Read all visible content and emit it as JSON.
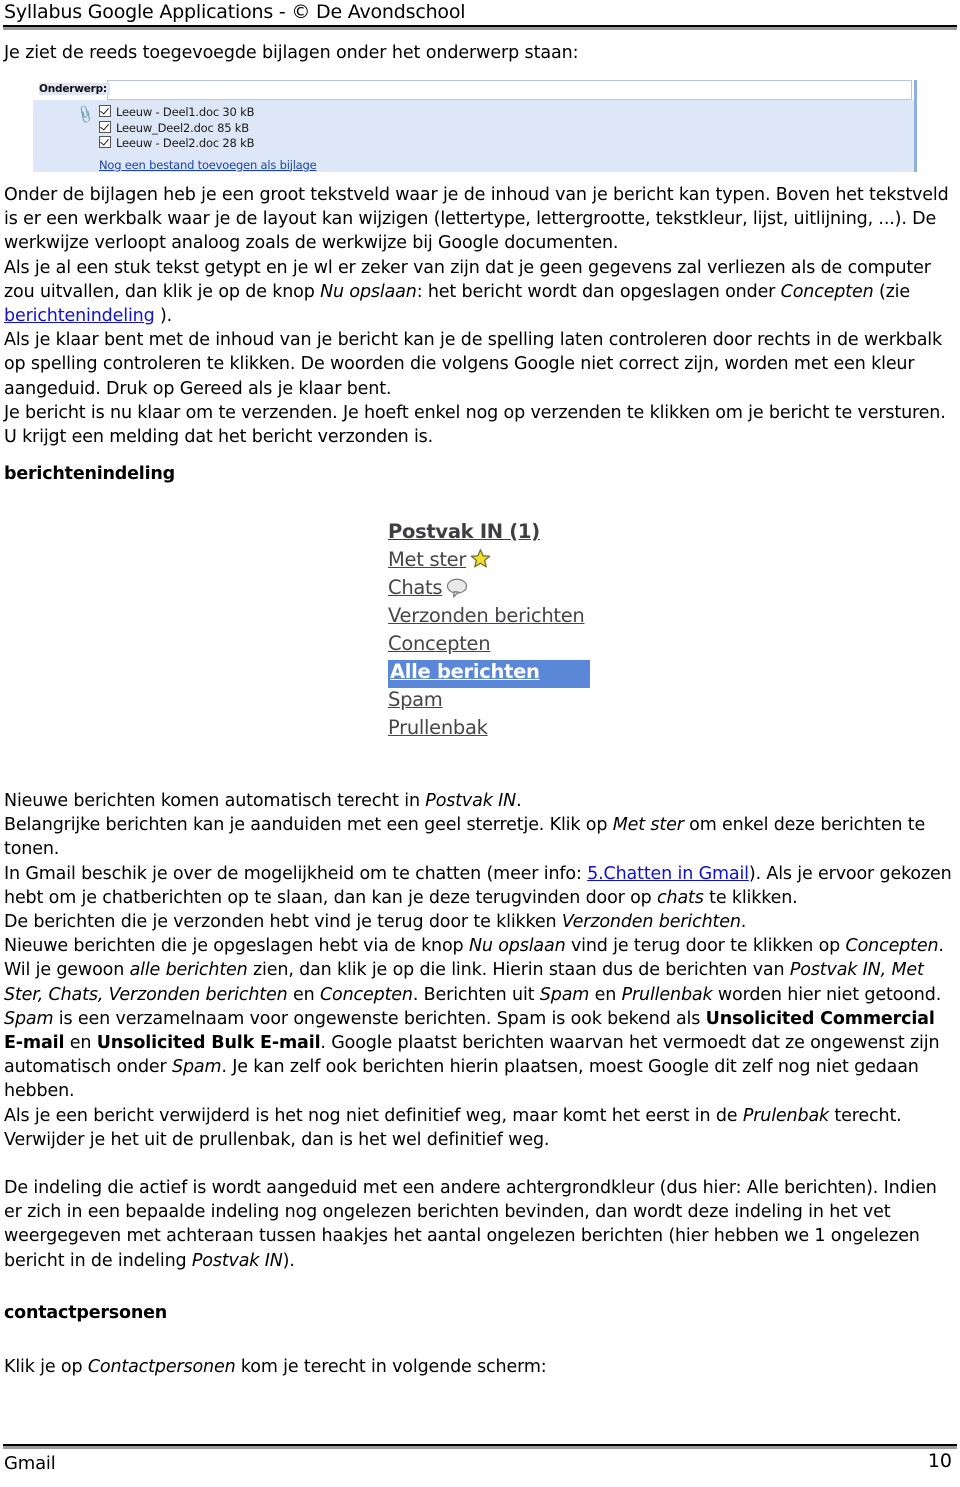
{
  "header": {
    "title": "Syllabus Google Applications - © De Avondschool"
  },
  "intro_line": "Je ziet de reeds toegevoegde bijlagen onder het onderwerp staan:",
  "attachment_screenshot": {
    "subject_label": "Onderwerp:",
    "subject_value": "",
    "clip_icon": "paperclip-icon",
    "attachments": [
      {
        "checked": true,
        "name": "Leeuw - Deel1.doc",
        "size": "30 kB"
      },
      {
        "checked": true,
        "name": "Leeuw_Deel2.doc",
        "size": "85 kB"
      },
      {
        "checked": true,
        "name": "Leeuw - Deel2.doc",
        "size": "28 kB"
      }
    ],
    "add_more_link": "Nog een bestand toevoegen als bijlage"
  },
  "paragraphs": {
    "p1_a": "Onder de bijlagen heb je een groot tekstveld waar je de inhoud van je bericht kan typen. Boven het tekstveld is er een werkbalk waar je de layout kan wijzigen (lettertype, lettergrootte, tekstkleur, lijst, uitlijning, ...). De werkwijze verloopt analoog zoals de werkwijze bij Google documenten.",
    "p2_a": "Als je al een stuk tekst getypt en je wl er zeker van zijn dat je geen gegevens zal verliezen als de computer zou uitvallen, dan klik je op de knop ",
    "p2_em1": "Nu opslaan",
    "p2_b": ": het bericht wordt dan opgeslagen onder ",
    "p2_em2": "Concepten",
    "p2_c": " (zie ",
    "p2_link": "berichtenindeling",
    "p2_d": " ).",
    "p3_a": "Als je klaar bent met de inhoud van je bericht kan je de spelling laten controleren door rechts in de werkbalk op spelling controleren te klikken. De woorden die volgens Google niet correct zijn, worden met een kleur aangeduid. Druk op Gereed als je klaar bent.",
    "p4_a": "Je bericht is nu klaar om te verzenden. Je hoeft enkel nog op verzenden te klikken om je bericht te versturen. U krijgt een melding dat het bericht verzonden is."
  },
  "heading_berichtenindeling": "berichtenindeling",
  "labels_screenshot": {
    "items": [
      {
        "label": "Postvak IN (1)",
        "bold": true,
        "active": false,
        "icon": ""
      },
      {
        "label": "Met ster",
        "bold": false,
        "active": false,
        "icon": "star-icon"
      },
      {
        "label": "Chats",
        "bold": false,
        "active": false,
        "icon": "chat-bubble-icon"
      },
      {
        "label": "Verzonden berichten",
        "bold": false,
        "active": false,
        "icon": ""
      },
      {
        "label": "Concepten",
        "bold": false,
        "active": false,
        "icon": ""
      },
      {
        "label": "Alle berichten",
        "bold": true,
        "active": true,
        "icon": ""
      },
      {
        "label": "Spam",
        "bold": false,
        "active": false,
        "icon": ""
      },
      {
        "label": "Prullenbak",
        "bold": false,
        "active": false,
        "icon": ""
      }
    ],
    "active_highlight_color": "#5b87d8",
    "star_color": "#f2d624",
    "text_color": "#44464a"
  },
  "body2": {
    "b1_a": "Nieuwe berichten komen automatisch terecht in ",
    "b1_em": "Postvak IN",
    "b1_b": ".",
    "b2_a": "Belangrijke berichten kan je aanduiden met een geel sterretje. Klik op ",
    "b2_em": "Met ster",
    "b2_b": " om enkel deze berichten te tonen.",
    "b3_a": "In Gmail beschik je over de mogelijkheid om te chatten (meer info: ",
    "b3_link": "5.Chatten in Gmail",
    "b3_b": "). Als je ervoor gekozen hebt om je chatberichten op te slaan, dan kan je deze terugvinden door op ",
    "b3_em": "chats",
    "b3_c": " te klikken.",
    "b4_a": "De berichten die je verzonden hebt vind je terug door te klikken ",
    "b4_em": "Verzonden berichten",
    "b4_b": ".",
    "b5_a": "Nieuwe berichten die je opgeslagen hebt via de knop ",
    "b5_em1": "Nu opslaan",
    "b5_b": " vind je terug door te klikken op ",
    "b5_em2": "Concepten",
    "b5_c": ".",
    "b6_a": "Wil je gewoon ",
    "b6_em1": "alle berichten",
    "b6_b": " zien, dan klik je op die link. Hierin staan dus de berichten van ",
    "b6_em2": "Postvak IN, Met Ster, Chats, Verzonden berichten",
    "b6_c": " en ",
    "b6_em3": "Concepten",
    "b6_d": ". Berichten uit ",
    "b6_em4": "Spam",
    "b6_e": " en ",
    "b6_em5": "Prullenbak",
    "b6_f": " worden hier niet getoond.",
    "b7_em1": "Spam",
    "b7_a": " is een verzamelnaam voor ongewenste berichten. Spam is ook bekend als ",
    "b7_bold1": "Unsolicited Commercial E-mail",
    "b7_b": " en ",
    "b7_bold2": "Unsolicited Bulk E-mail",
    "b7_c": ". Google plaatst berichten waarvan het vermoedt dat ze ongewenst zijn automatisch onder ",
    "b7_em2": "Spam",
    "b7_d": ". Je kan zelf ook berichten hierin plaatsen, moest Google dit zelf nog niet gedaan hebben.",
    "b8_a": "Als je een bericht verwijderd is het nog niet definitief weg, maar komt het eerst in de ",
    "b8_em": "Prulenbak",
    "b8_b": " terecht. Verwijder je het uit de prullenbak, dan is het wel definitief weg.",
    "b9_a": "De indeling die actief is wordt aangeduid met een andere achtergrondkleur (dus hier: Alle berichten). Indien er zich in een bepaalde indeling nog ongelezen berichten bevinden, dan wordt deze indeling in het vet weergegeven met achteraan tussen haakjes het aantal ongelezen berichten (hier hebben we 1 ongelezen bericht in de indeling ",
    "b9_em": "Postvak IN",
    "b9_b": ")."
  },
  "heading_contactpersonen": "contactpersonen",
  "closing": {
    "c_a": "Klik je op ",
    "c_em": "Contactpersonen",
    "c_b": " kom je terecht in volgende scherm:"
  },
  "footer": {
    "left": "Gmail",
    "page": "10"
  }
}
